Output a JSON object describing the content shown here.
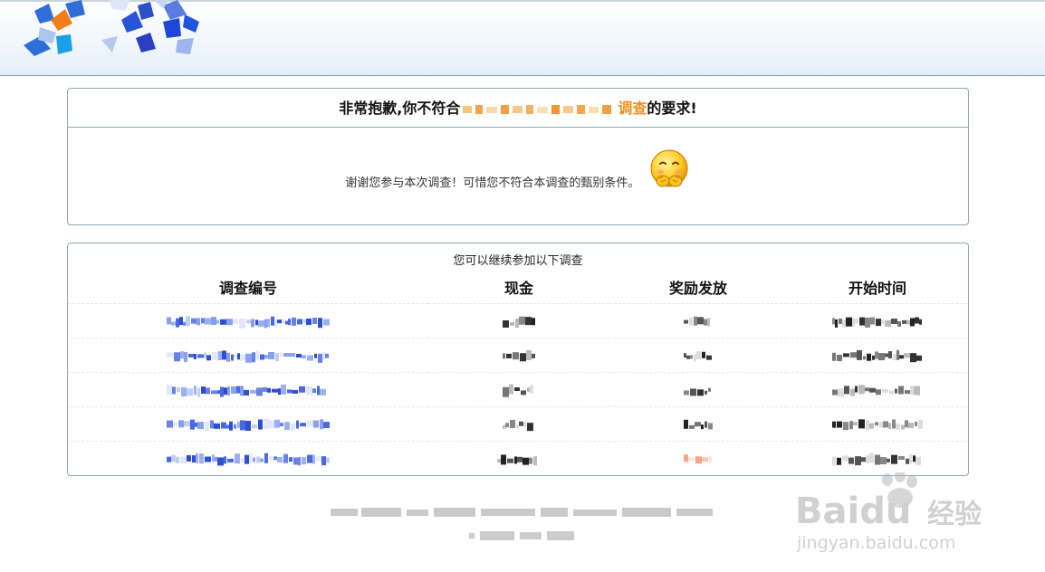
{
  "sorry": {
    "title_prefix": "非常抱歉,你不符合",
    "survey_name_tail": "调查",
    "title_suffix": "的要求!",
    "message": "谢谢您参与本次调查！可惜您不符合本调查的甄别条件。",
    "emoji_icon": "shy-smiley-icon"
  },
  "surveys": {
    "subtitle": "您可以继续参加以下调查",
    "columns": [
      "调查编号",
      "现金",
      "奖励发放",
      "开始时间"
    ],
    "row_count": 5
  },
  "watermark": {
    "brand": "Baidu",
    "brand_cn": "经验",
    "url": "jingyan.baidu.com"
  },
  "colors": {
    "accent_orange": "#f0901c",
    "border_blue": "#8fa6bb",
    "header_line": "#7ea0bc"
  }
}
